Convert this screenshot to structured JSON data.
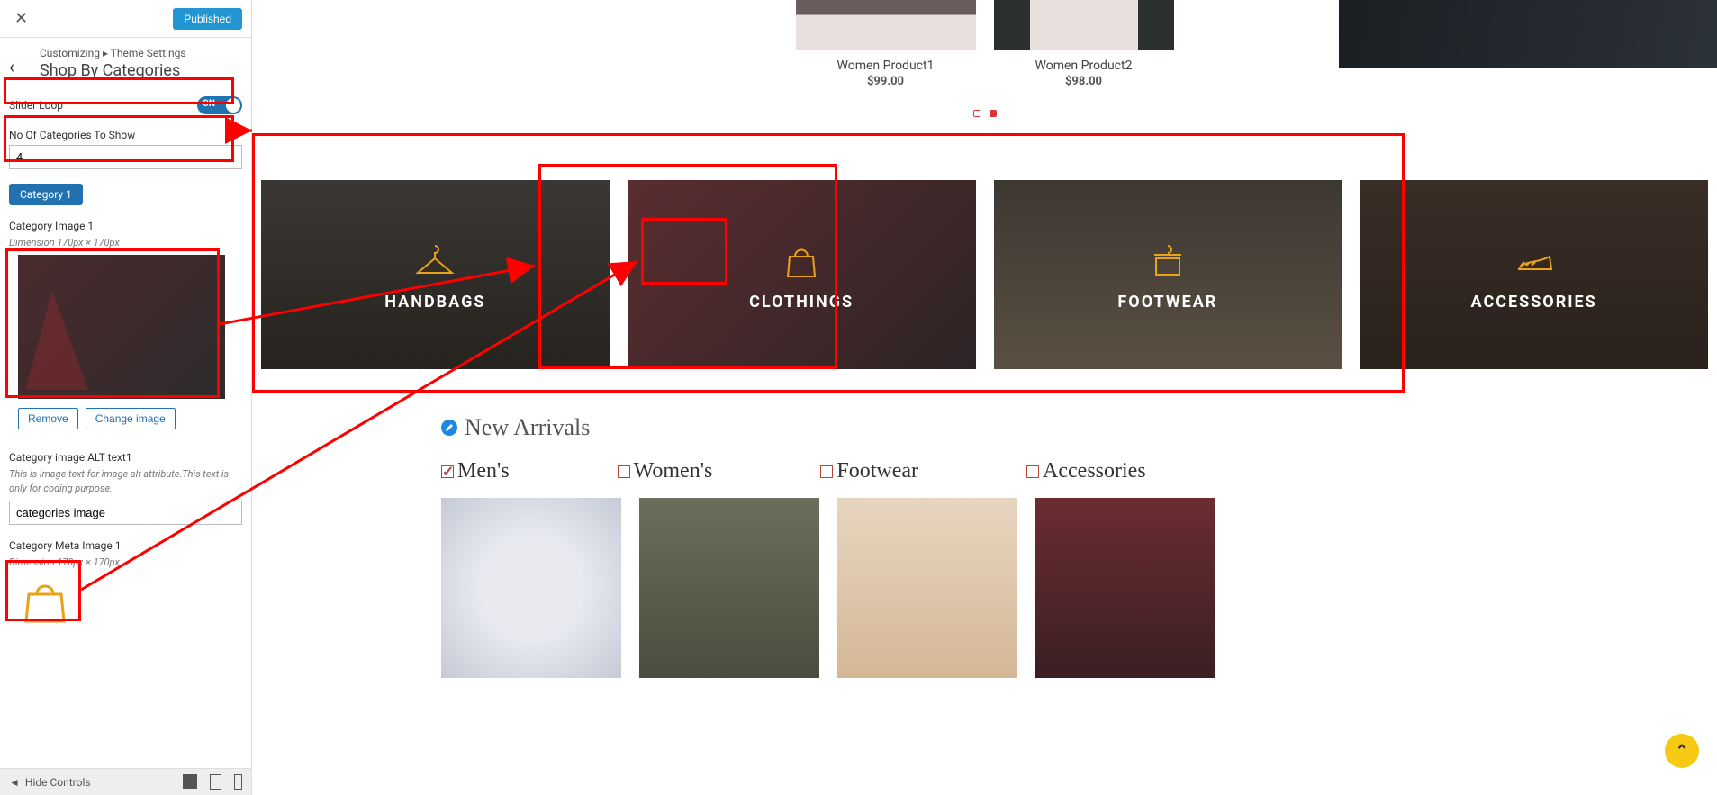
{
  "sidebar": {
    "publish_btn": "Published",
    "breadcrumb_prefix": "Customizing",
    "breadcrumb_sep": "▸",
    "breadcrumb_parent": "Theme Settings",
    "section_title": "Shop By Categories",
    "slider_loop_label": "Slider Loop",
    "slider_loop_state": "ON",
    "num_cats_label": "No Of Categories To Show",
    "num_cats_value": "4",
    "category_chip": "Category 1",
    "cat_image_label": "Category Image 1",
    "cat_image_dim": "Dimension 170px × 170px",
    "remove_btn": "Remove",
    "change_btn": "Change image",
    "alt_label": "Category image ALT text1",
    "alt_help": "This is image text for image alt attribute.This text is only for coding purpose.",
    "alt_value": "categories image",
    "meta_label": "Category Meta Image 1",
    "meta_dim": "Dimension 170px × 170px",
    "hide_controls": "Hide Controls"
  },
  "preview": {
    "products": [
      {
        "name": "Women Product1",
        "price": "$99.00"
      },
      {
        "name": "Women Product2",
        "price": "$98.00"
      }
    ],
    "categories": [
      {
        "name": "HANDBAGS",
        "icon": "hanger"
      },
      {
        "name": "CLOTHINGS",
        "icon": "bag"
      },
      {
        "name": "FOOTWEAR",
        "icon": "shirt"
      },
      {
        "name": "ACCESSORIES",
        "icon": "shoe"
      }
    ],
    "arrivals_title": "New Arrivals",
    "arrivals_tabs": [
      {
        "label": "Men's",
        "checked": true
      },
      {
        "label": "Women's",
        "checked": false
      },
      {
        "label": "Footwear",
        "checked": false
      },
      {
        "label": "Accessories",
        "checked": false
      }
    ],
    "scroll_top": "⌃"
  }
}
